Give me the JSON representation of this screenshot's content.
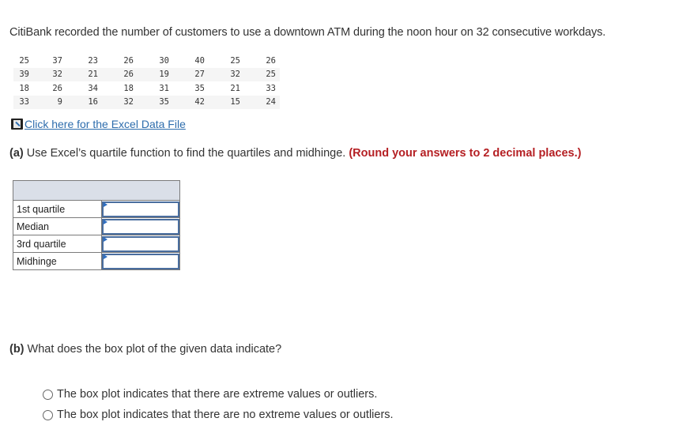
{
  "intro_text": "CitiBank recorded the number of customers to use a downtown ATM during the noon hour on 32 consecutive workdays.",
  "data_rows": [
    [
      "25",
      "37",
      "23",
      "26",
      "30",
      "40",
      "25",
      "26"
    ],
    [
      "39",
      "32",
      "21",
      "26",
      "19",
      "27",
      "32",
      "25"
    ],
    [
      "18",
      "26",
      "34",
      "18",
      "31",
      "35",
      "21",
      "33"
    ],
    [
      "33",
      "9",
      "16",
      "32",
      "35",
      "42",
      "15",
      "24"
    ]
  ],
  "excel_link": {
    "icon": "excel-file-icon",
    "label": "Click here for the Excel Data File"
  },
  "part_a": {
    "prefix": "(a)",
    "text": " Use Excel’s quartile function to find the quartiles and midhinge. ",
    "note": "(Round your answers to 2 decimal places.)"
  },
  "answer_table": {
    "header": "",
    "rows": [
      {
        "label": "1st quartile",
        "value": ""
      },
      {
        "label": "Median",
        "value": ""
      },
      {
        "label": "3rd quartile",
        "value": ""
      },
      {
        "label": "Midhinge",
        "value": ""
      }
    ]
  },
  "part_b": {
    "prefix": "(b)",
    "text": " What does the box plot of the given data indicate?",
    "options": [
      "The box plot indicates that there are extreme values or outliers.",
      "The box plot indicates that there are no extreme values or outliers."
    ]
  },
  "colors": {
    "link": "#2e6dad",
    "note_red": "#b52024",
    "header_bg": "#dadfe8",
    "input_border": "#4a6e9f"
  }
}
